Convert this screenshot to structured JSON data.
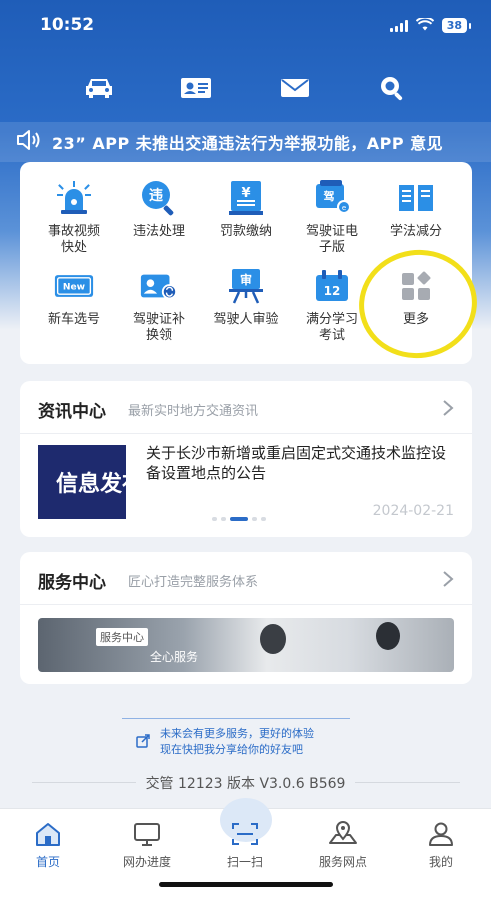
{
  "status_bar": {
    "time": "10:52",
    "battery": "38"
  },
  "top_nav": [
    "car-icon",
    "license-card-icon",
    "mail-icon",
    "search-icon"
  ],
  "marquee": {
    "text": "23” APP 未推出交通违法行为举报功能，APP 意见"
  },
  "grid": [
    {
      "icon": "alarm-light-icon",
      "label_line1": "事故视频",
      "label_line2": "快处"
    },
    {
      "icon": "violation-magnifier-icon",
      "label_line1": "违法处理",
      "label_line2": ""
    },
    {
      "icon": "fine-payment-icon",
      "label_line1": "罚款缴纳",
      "label_line2": ""
    },
    {
      "icon": "e-license-icon",
      "label_line1": "驾驶证电",
      "label_line2": "子版"
    },
    {
      "icon": "study-book-icon",
      "label_line1": "学法减分",
      "label_line2": ""
    },
    {
      "icon": "new-plate-icon",
      "label_line1": "新车选号",
      "label_line2": ""
    },
    {
      "icon": "license-renew-icon",
      "label_line1": "驾驶证补",
      "label_line2": "换领"
    },
    {
      "icon": "driver-review-icon",
      "label_line1": "驾驶人审验",
      "label_line2": ""
    },
    {
      "icon": "calendar-12-icon",
      "label_line1": "满分学习",
      "label_line2": "考试"
    },
    {
      "icon": "more-grid-icon",
      "label_line1": "更多",
      "label_line2": ""
    }
  ],
  "news": {
    "title": "资讯中心",
    "subtitle": "最新实时地方交通资讯",
    "thumb_text": "信息发布",
    "headline": "关于长沙市新增或重启固定式交通技术监控设备设置地点的公告",
    "date": "2024-02-21"
  },
  "service": {
    "title": "服务中心",
    "subtitle": "匠心打造完整服务体系",
    "banner_tag": "服务中心",
    "banner_slogan": "全心服务"
  },
  "promo": {
    "line1": "未来会有更多服务，更好的体验",
    "line2": "现在快把我分享给你的好友吧"
  },
  "version": "交管 12123 版本 V3.0.6 B569",
  "tabs": [
    {
      "label": "首页",
      "icon": "home-icon",
      "active": true
    },
    {
      "label": "网办进度",
      "icon": "monitor-icon",
      "active": false
    },
    {
      "label": "扫一扫",
      "icon": "scan-icon",
      "active": false
    },
    {
      "label": "服务网点",
      "icon": "map-pin-icon",
      "active": false
    },
    {
      "label": "我的",
      "icon": "user-icon",
      "active": false
    }
  ],
  "colors": {
    "brand": "#2b6cc7",
    "highlight": "#f2df1a"
  }
}
